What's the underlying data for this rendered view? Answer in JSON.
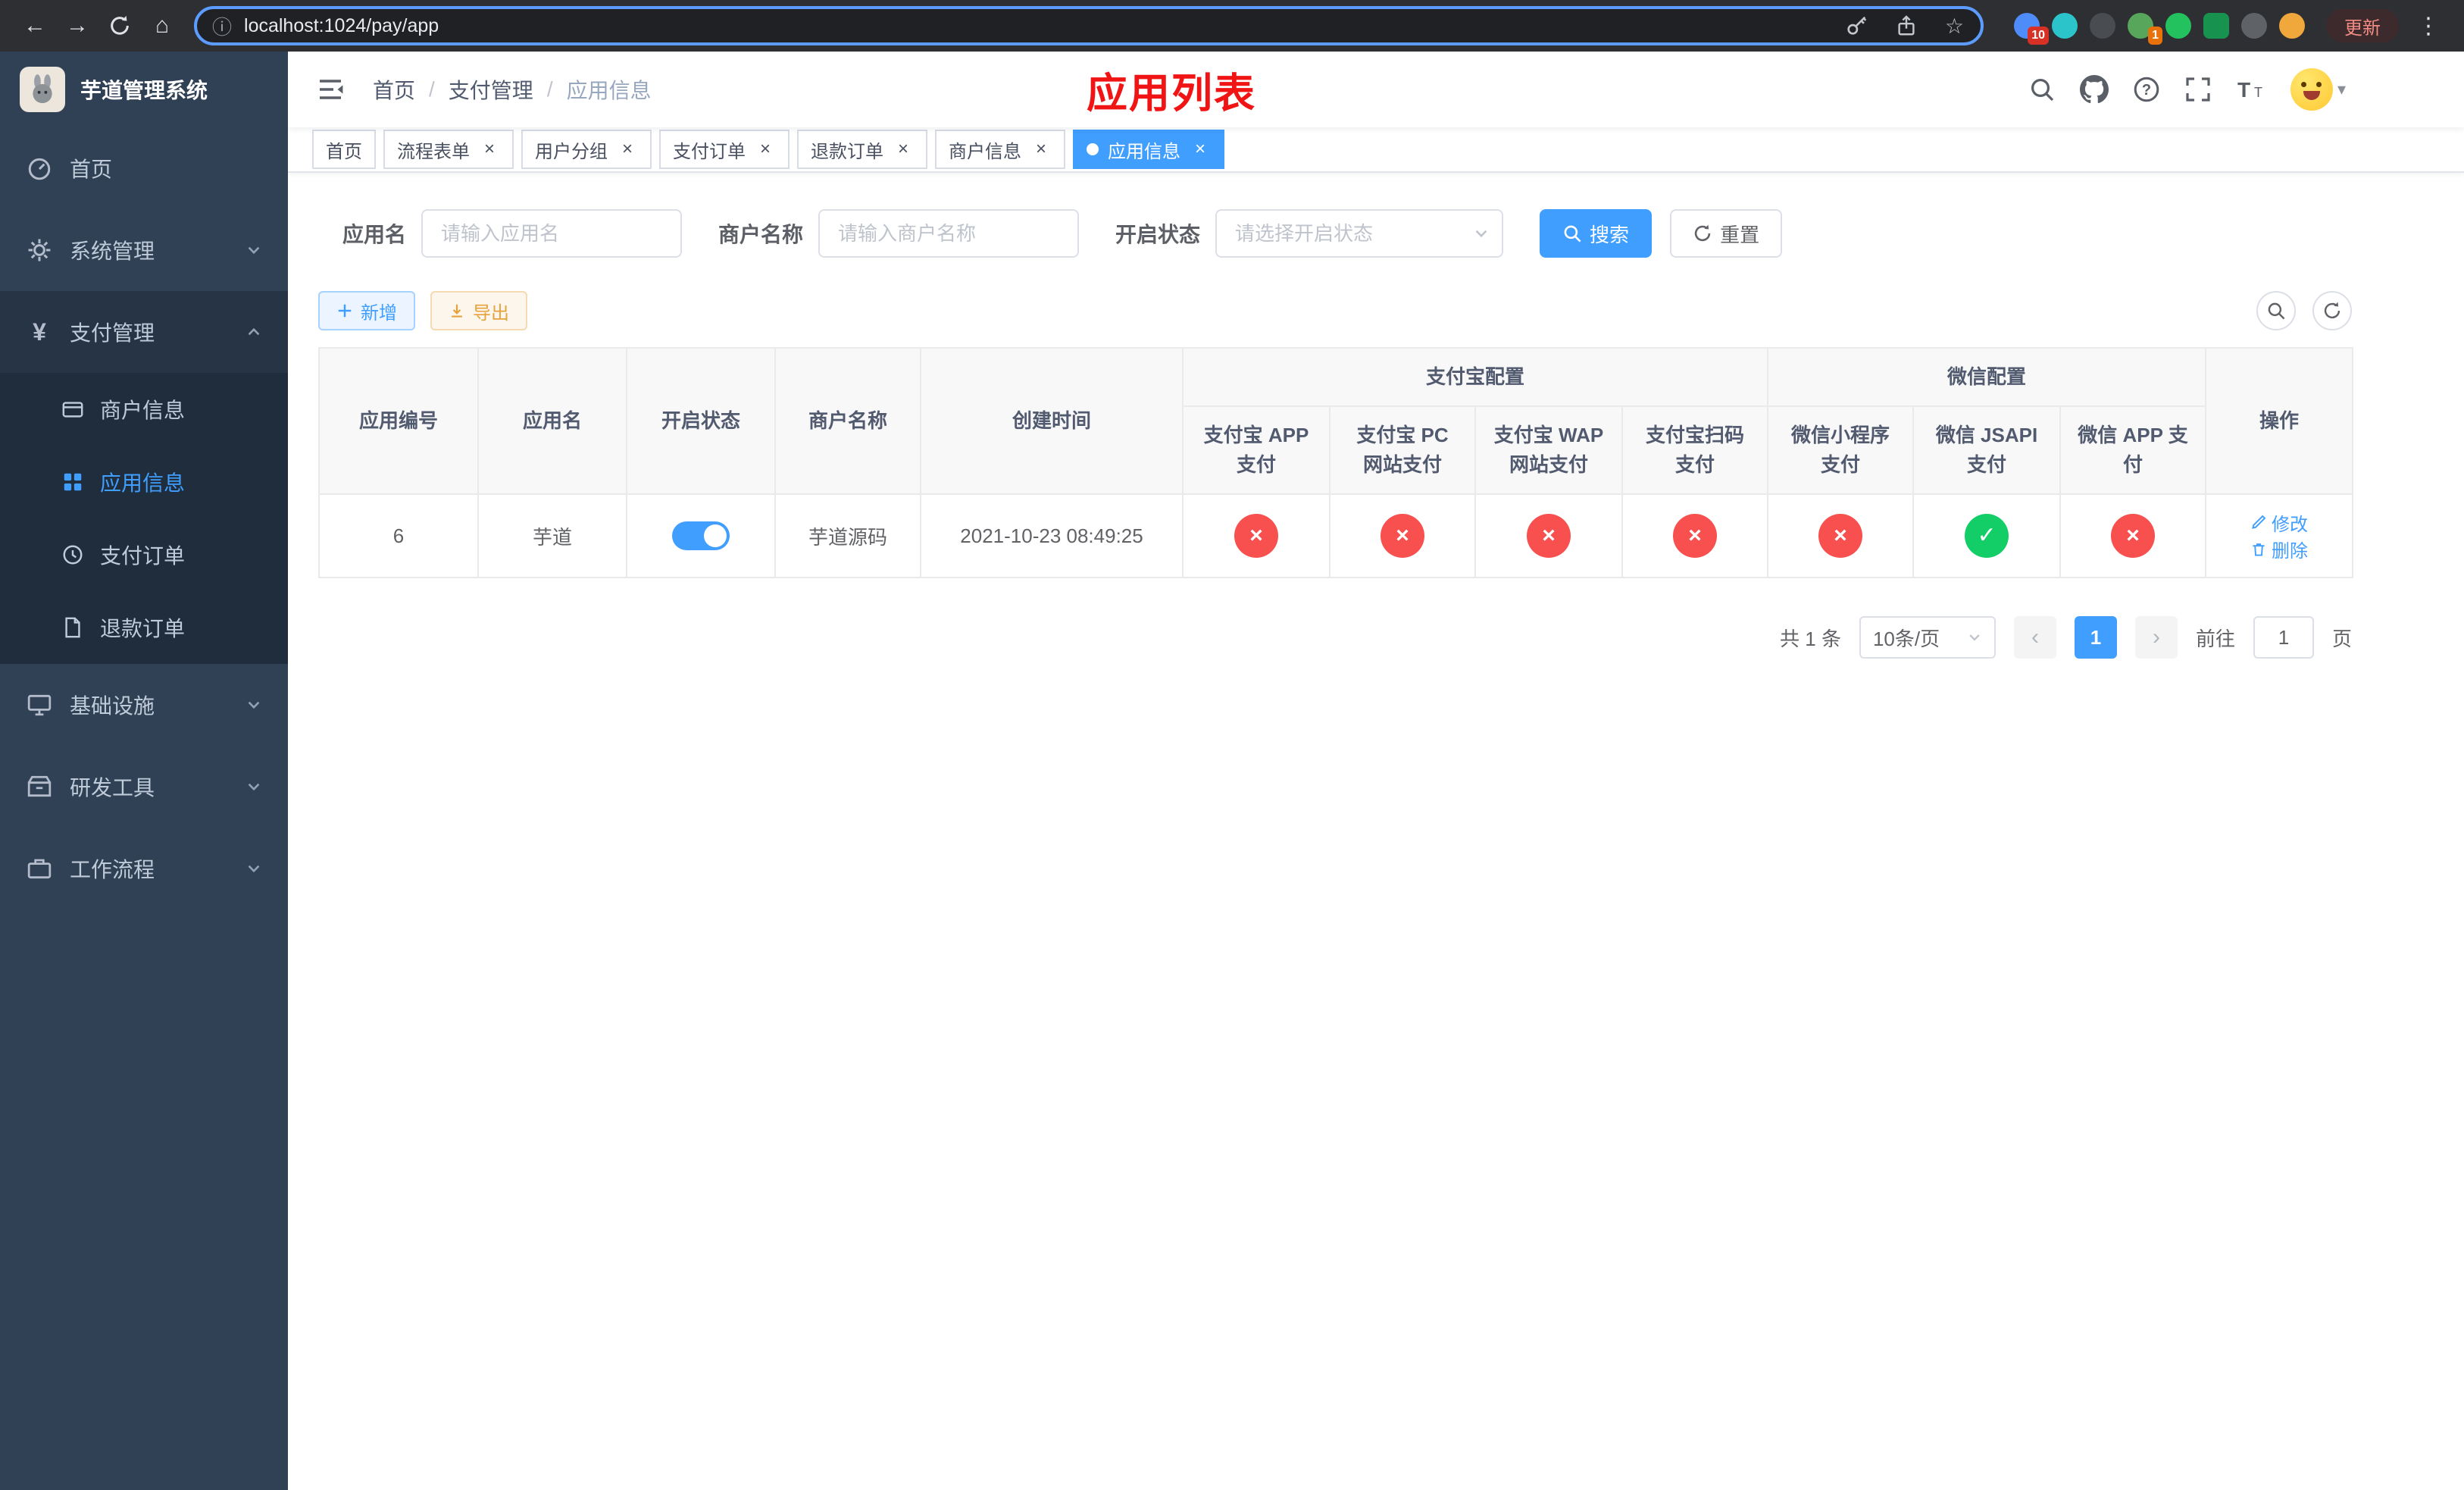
{
  "colors": {
    "accent": "#409eff",
    "success": "#13ce66",
    "danger": "#f7504f",
    "warning": "#e6a23c",
    "sidebar_bg": "#304156",
    "submenu_bg": "#1f2d3d",
    "annotation_red": "#f01414"
  },
  "icons": {
    "back": "←",
    "forward": "→",
    "home": "⌂",
    "info": "ⓘ",
    "star": "☆",
    "kebab": "⋮",
    "caret_down": "▾",
    "check": "✓",
    "cross": "×",
    "prev": "‹",
    "next": "›",
    "slash": "/",
    "yen": "¥"
  },
  "browser": {
    "url": "localhost:1024/pay/app",
    "update_label": "更新",
    "ext_badge_red": "10",
    "ext_badge_orange": "1"
  },
  "sidebar": {
    "title": "芋道管理系统",
    "items": {
      "home": "首页",
      "system": "系统管理",
      "payment": "支付管理",
      "infra": "基础设施",
      "devtools": "研发工具",
      "workflow": "工作流程"
    },
    "payment_children": {
      "merchant": "商户信息",
      "app": "应用信息",
      "order": "支付订单",
      "refund": "退款订单"
    }
  },
  "header": {
    "breadcrumb": {
      "home": "首页",
      "payment": "支付管理",
      "current": "应用信息"
    },
    "annotation": "应用列表"
  },
  "tabs": [
    {
      "label": "首页",
      "closable": false,
      "active": false
    },
    {
      "label": "流程表单",
      "closable": true,
      "active": false
    },
    {
      "label": "用户分组",
      "closable": true,
      "active": false
    },
    {
      "label": "支付订单",
      "closable": true,
      "active": false
    },
    {
      "label": "退款订单",
      "closable": true,
      "active": false
    },
    {
      "label": "商户信息",
      "closable": true,
      "active": false
    },
    {
      "label": "应用信息",
      "closable": true,
      "active": true
    }
  ],
  "filters": {
    "app_name_label": "应用名",
    "app_name_placeholder": "请输入应用名",
    "app_name_value": "",
    "merchant_label": "商户名称",
    "merchant_placeholder": "请输入商户名称",
    "merchant_value": "",
    "status_label": "开启状态",
    "status_placeholder": "请选择开启状态",
    "search_label": "搜索",
    "reset_label": "重置"
  },
  "toolbar": {
    "add_label": "新增",
    "export_label": "导出"
  },
  "table": {
    "columns": {
      "app_id": "应用编号",
      "app_name": "应用名",
      "status": "开启状态",
      "merchant": "商户名称",
      "created": "创建时间",
      "alipay_group": "支付宝配置",
      "wechat_group": "微信配置",
      "actions": "操作",
      "alipay_app": "支付宝 APP 支付",
      "alipay_pc": "支付宝 PC 网站支付",
      "alipay_wap": "支付宝 WAP 网站支付",
      "alipay_scan": "支付宝扫码支付",
      "wx_mini": "微信小程序支付",
      "wx_jsapi": "微信 JSAPI 支付",
      "wx_app": "微信 APP 支付"
    },
    "row": {
      "app_id": "6",
      "app_name": "芋道",
      "enabled": true,
      "merchant": "芋道源码",
      "created": "2021-10-23 08:49:25",
      "statuses": [
        false,
        false,
        false,
        false,
        false,
        true,
        false
      ],
      "edit_label": "修改",
      "delete_label": "删除"
    }
  },
  "pagination": {
    "total": "共 1 条",
    "page_size": "10条/页",
    "current_page": "1",
    "goto_label": "前往",
    "goto_value": "1",
    "goto_suffix": "页"
  }
}
